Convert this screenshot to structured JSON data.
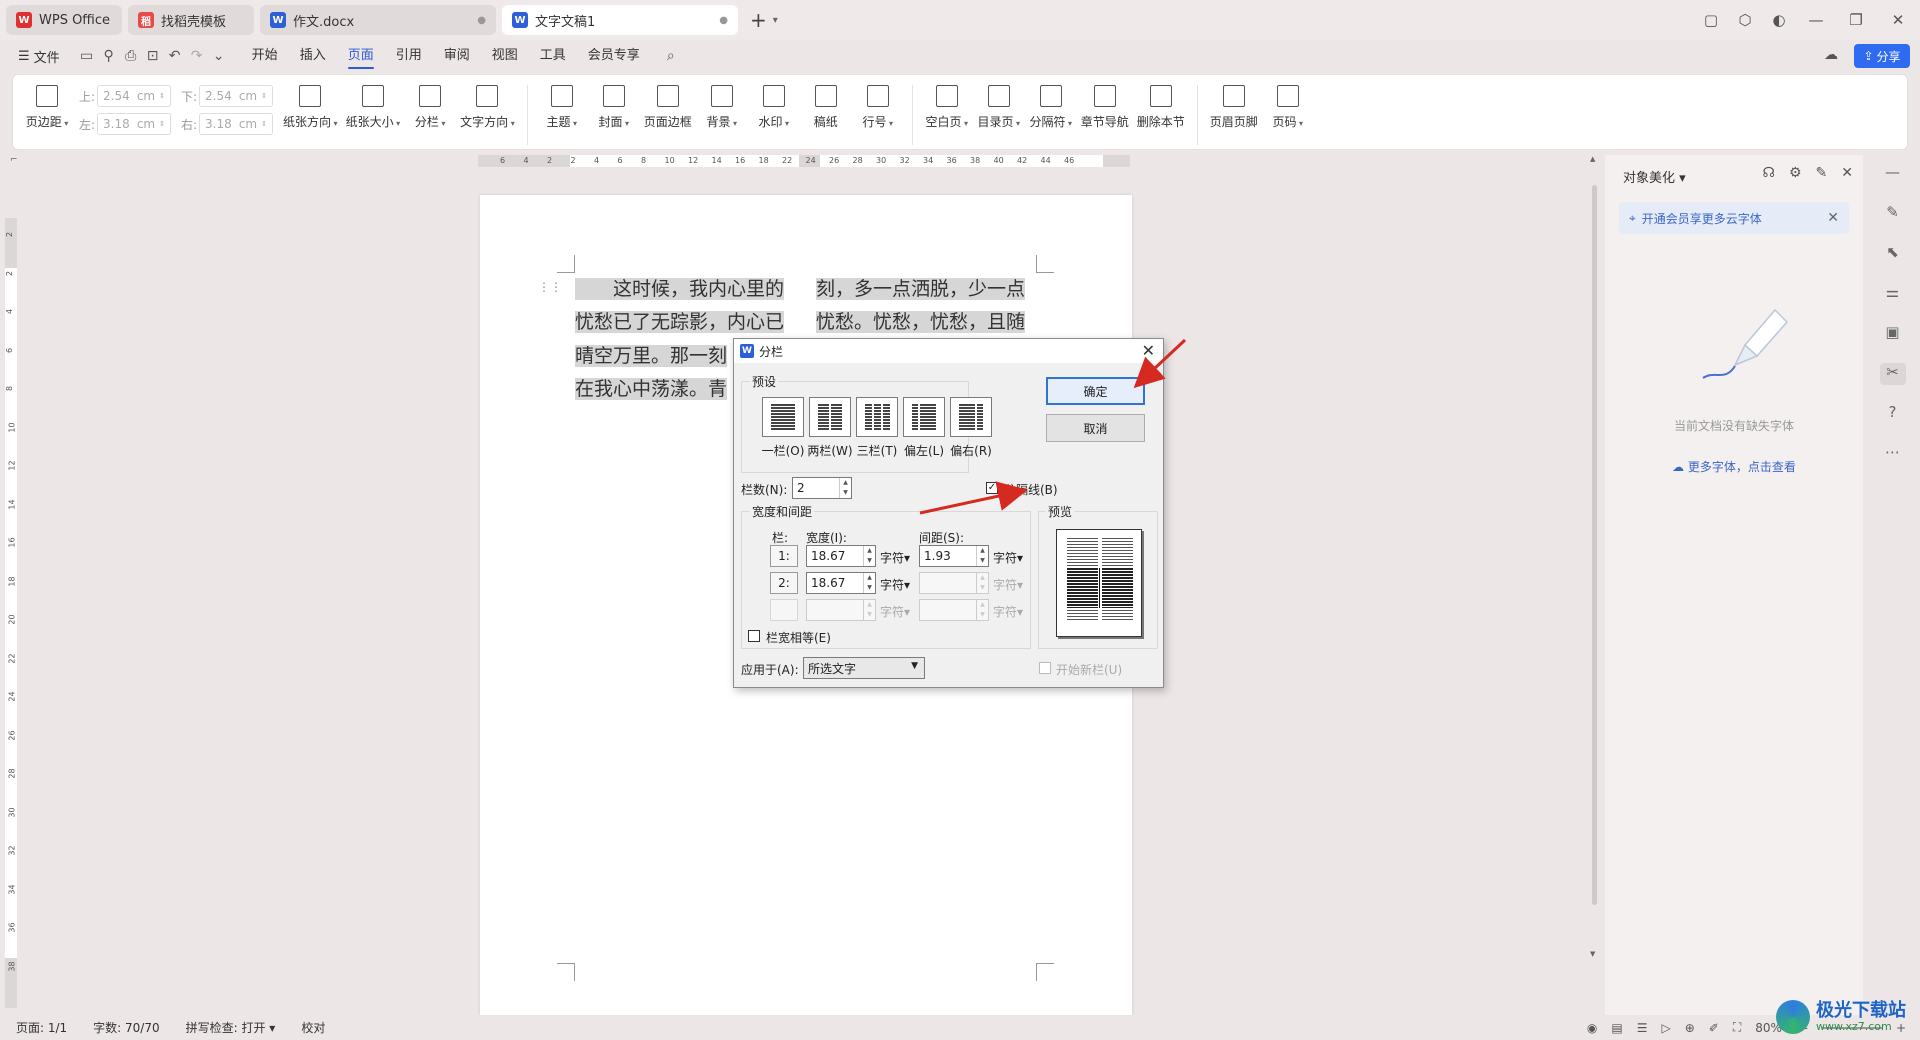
{
  "tabs": [
    {
      "label": "WPS Office",
      "state": "inactive"
    },
    {
      "label": "找稻壳模板",
      "state": "inactive"
    },
    {
      "label": "作文.docx",
      "state": "inactive"
    },
    {
      "label": "文字文稿1",
      "state": "active"
    }
  ],
  "menu": {
    "file": "文件",
    "tabs": [
      "开始",
      "插入",
      "页面",
      "引用",
      "审阅",
      "视图",
      "工具",
      "会员专享"
    ],
    "active_tab": "页面",
    "share": "分享"
  },
  "ribbon": {
    "page_margin": "页边距",
    "margins": {
      "top_label": "上:",
      "top_value": "2.54",
      "bottom_label": "下:",
      "bottom_value": "2.54",
      "left_label": "左:",
      "left_value": "3.18",
      "right_label": "右:",
      "right_value": "3.18",
      "unit": "cm"
    },
    "buttons": [
      {
        "label": "纸张方向",
        "icon": "page-orientation-icon",
        "drop": true
      },
      {
        "label": "纸张大小",
        "icon": "page-size-icon",
        "drop": true
      },
      {
        "label": "分栏",
        "icon": "columns-icon",
        "drop": true
      },
      {
        "label": "文字方向",
        "icon": "text-direction-icon",
        "drop": true
      },
      {
        "label": "主题",
        "icon": "theme-icon",
        "drop": true
      },
      {
        "label": "封面",
        "icon": "cover-icon",
        "drop": true
      },
      {
        "label": "页面边框",
        "icon": "page-border-icon",
        "drop": false
      },
      {
        "label": "背景",
        "icon": "background-icon",
        "drop": true
      },
      {
        "label": "水印",
        "icon": "watermark-icon",
        "drop": true
      },
      {
        "label": "稿纸",
        "icon": "manuscript-icon",
        "drop": false
      },
      {
        "label": "行号",
        "icon": "line-number-icon",
        "drop": true
      },
      {
        "label": "空白页",
        "icon": "blank-page-icon",
        "drop": true
      },
      {
        "label": "目录页",
        "icon": "toc-page-icon",
        "drop": true
      },
      {
        "label": "分隔符",
        "icon": "separator-icon",
        "drop": true
      },
      {
        "label": "章节导航",
        "icon": "section-nav-icon",
        "drop": false
      },
      {
        "label": "删除本节",
        "icon": "delete-section-icon",
        "drop": false
      },
      {
        "label": "页眉页脚",
        "icon": "header-footer-icon",
        "drop": false
      },
      {
        "label": "页码",
        "icon": "page-number-icon",
        "drop": true
      }
    ]
  },
  "ruler": {
    "h_numbers": [
      "6",
      "4",
      "2",
      "2",
      "4",
      "6",
      "8",
      "10",
      "12",
      "14",
      "16",
      "18",
      "22",
      "24",
      "26",
      "28",
      "30",
      "32",
      "34",
      "36",
      "38",
      "40",
      "42",
      "44",
      "46"
    ],
    "v_numbers": [
      "2",
      "2",
      "4",
      "6",
      "8",
      "10",
      "12",
      "14",
      "16",
      "18",
      "20",
      "22",
      "24",
      "26",
      "28",
      "30",
      "32",
      "34",
      "36",
      "38"
    ]
  },
  "document": {
    "col1_lines": [
      "　　这时候，我内心里的",
      "忧愁已了无踪影，内心已",
      "晴空万里。那一刻",
      "在我心中荡漾。青"
    ],
    "col2_lines": [
      "刻，多一点洒脱，少一点",
      "忧愁。忧愁，忧愁，且随",
      "",
      ""
    ]
  },
  "panel": {
    "title": "对象美化",
    "notice": "开通会员享更多云字体",
    "empty_text": "当前文档没有缺失字体",
    "more_fonts": "更多字体，点击查看"
  },
  "dialog": {
    "title": "分栏",
    "presets_group": "预设",
    "presets": [
      "一栏(O)",
      "两栏(W)",
      "三栏(T)",
      "偏左(L)",
      "偏右(R)"
    ],
    "ok": "确定",
    "cancel": "取消",
    "num_cols_label": "栏数(N):",
    "num_cols_value": "2",
    "separator_label": "分隔线(B)",
    "separator_checked": true,
    "width_group": "宽度和间距",
    "col_header": "栏:",
    "width_header": "宽度(I):",
    "spacing_header": "间距(S):",
    "rows": [
      {
        "num": "1:",
        "width": "18.67",
        "width_unit": "字符",
        "spacing": "1.93",
        "spacing_unit": "字符",
        "enabled": true,
        "spacing_enabled": true
      },
      {
        "num": "2:",
        "width": "18.67",
        "width_unit": "字符",
        "spacing": "",
        "spacing_unit": "字符",
        "enabled": true,
        "spacing_enabled": false
      },
      {
        "num": "",
        "width": "",
        "width_unit": "字符",
        "spacing": "",
        "spacing_unit": "字符",
        "enabled": false,
        "spacing_enabled": false
      }
    ],
    "equal_width_label": "栏宽相等(E)",
    "preview_label": "预览",
    "apply_label": "应用于(A):",
    "apply_value": "所选文字",
    "new_column_label": "开始新栏(U)"
  },
  "status": {
    "page": "页面: 1/1",
    "words": "字数: 70/70",
    "spell": "拼写检查: 打开",
    "proof": "校对",
    "zoom": "80%"
  },
  "watermark": {
    "line1": "极光下载站",
    "line2": "www.xz7.com"
  },
  "colors": {
    "accent": "#2b5bd6",
    "share": "#2f6bf0",
    "arrow": "#d42a1f"
  }
}
